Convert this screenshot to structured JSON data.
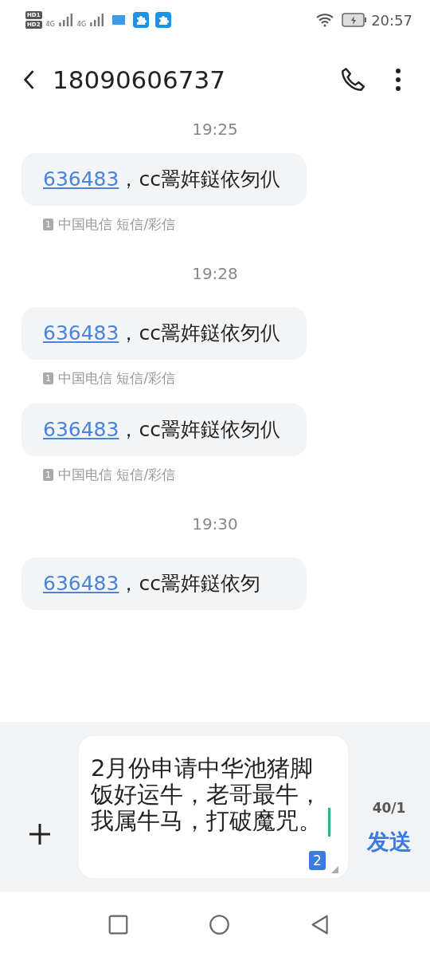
{
  "status_bar": {
    "sim_labels": [
      "HD1",
      "HD2"
    ],
    "networks": [
      "4G",
      "4G"
    ],
    "time": "20:57"
  },
  "header": {
    "title": "18090606737"
  },
  "thread": [
    {
      "kind": "time",
      "text": "19:25"
    },
    {
      "kind": "message",
      "link": "636483",
      "text": "，cc翯姩鎹依匇仈",
      "sim": "1",
      "carrier": "中国电信 短信/彩信"
    },
    {
      "kind": "time",
      "text": "19:28"
    },
    {
      "kind": "message",
      "link": "636483",
      "text": "，cc翯姩鎹依匇仈",
      "sim": "1",
      "carrier": "中国电信 短信/彩信"
    },
    {
      "kind": "message",
      "link": "636483",
      "text": "，cc翯姩鎹依匇仈",
      "sim": "1",
      "carrier": "中国电信 短信/彩信"
    },
    {
      "kind": "time",
      "text": "19:30"
    },
    {
      "kind": "message",
      "link": "636483",
      "text": "，cc翯姩鎹依匇"
    }
  ],
  "composer": {
    "value": "2月份申请中华池猪脚饭好运牛，老哥最牛，我属牛马，打破魔咒。",
    "sim_badge": "2",
    "counter": "40/1",
    "send": "发送"
  }
}
